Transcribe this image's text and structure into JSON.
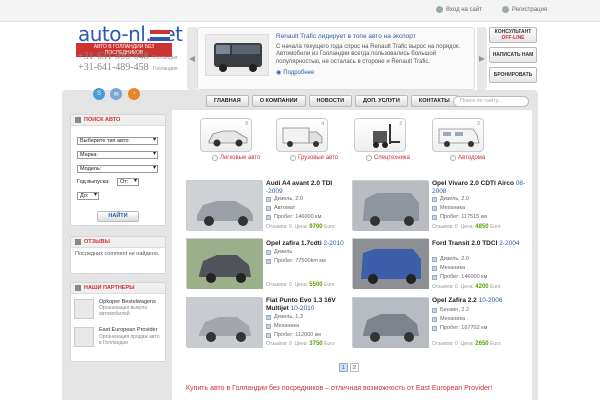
{
  "topbar": {
    "login": "Вход на сайт",
    "register": "Регистрация"
  },
  "logo": {
    "text": "auto-nl.net",
    "subtitle": "АВТО В ГОЛЛАНДИИ БЕЗ ПОСРЕДНИКОВ"
  },
  "phones": [
    {
      "number": "+31-631-993-048",
      "note": "Голландия"
    },
    {
      "number": "+31-641-489-458",
      "note": "Голландия"
    }
  ],
  "news": {
    "title": "Renault Trafic лидирует в топе авто на экспорт",
    "text": "С начала текущего года спрос на Renault Trafic вырос на порядок. Автомобили из Голландии всегда пользовались большой популярностью, не осталась в стороне и Renault Trafic.",
    "more": "Подробнее"
  },
  "side_buttons": [
    {
      "line1": "КОНСУЛЬТАНТ",
      "line2": "OFF-LINE"
    },
    {
      "line1": "НАПИСАТЬ НАМ",
      "line2": ""
    },
    {
      "line1": "БРОНИРОВАТЬ",
      "line2": ""
    }
  ],
  "nav": {
    "items": [
      "ГЛАВНАЯ",
      "О КОМПАНИИ",
      "НОВОСТИ",
      "ДОП. УСЛУГИ",
      "КОНТАКТЫ"
    ],
    "search_placeholder": "Поиск по сайту..."
  },
  "search_panel": {
    "title": "ПОИСК АВТО",
    "type_select": "Выберите тип авто:",
    "brand_select": "Марка:",
    "model_select": "Модель:",
    "year_label": "Год выпуска:",
    "year_from": "От:",
    "year_to": "До:",
    "find_button": "НАЙТИ"
  },
  "reviews": {
    "title": "ОТЗЫВЫ",
    "empty": "Последних comment не найдено."
  },
  "partners": {
    "title": "НАШИ ПАРТНЕРЫ",
    "items": [
      {
        "name": "Opkoper Bestelwagens",
        "desc": "Организация выкупа автомобилей"
      },
      {
        "name": "East European Provider",
        "desc": "Организация продаж авто в Голландии"
      }
    ]
  },
  "categories": [
    {
      "label": "Легковые авто",
      "count": "8"
    },
    {
      "label": "Грузовые авто",
      "count": "4"
    },
    {
      "label": "Спецтехника",
      "count": "2"
    },
    {
      "label": "Автодома",
      "count": "2"
    }
  ],
  "listings": [
    {
      "title": "Audi A4 avant 2.0 TDI",
      "year": "-2009",
      "specs": [
        "Дизель, 2.0",
        "Автомат",
        "Пробег: 146000 км"
      ],
      "reviews": "Отзывов: 0",
      "price_label": "Цена:",
      "price": "9700",
      "currency": "Euro"
    },
    {
      "title": "Opel Vivaro 2.0 CDTI Airco",
      "year": "08-2008",
      "specs": [
        "Дизель, 2.0",
        "Механика",
        "Пробег: 117515 км"
      ],
      "reviews": "Отзывов: 0",
      "price_label": "Цена:",
      "price": "4850",
      "currency": "Euro"
    },
    {
      "title": "Opel zafira 1.7cdti",
      "year": "2-2010",
      "specs": [
        "Дизель",
        "Пробег: 77500km км"
      ],
      "reviews": "Отзывов: 0",
      "price_label": "Цена:",
      "price": "5500",
      "currency": "Euro"
    },
    {
      "title": "Ford Transit 2.0 TDCI",
      "year": "2-2004",
      "specs": [
        "Дизель, 2.0",
        "Механика",
        "Пробег: 146000 км"
      ],
      "reviews": "Отзывов: 0",
      "price_label": "Цена:",
      "price": "4200",
      "currency": "Euro"
    },
    {
      "title": "Fiat Punto Evo 1.3 16V Multijet",
      "year": "10-2010",
      "specs": [
        "Дизель, 1.3",
        "Механика",
        "Пробег: 112000 км"
      ],
      "reviews": "Отзывов: 0",
      "price_label": "Цена:",
      "price": "3750",
      "currency": "Euro"
    },
    {
      "title": "Opel Zafira 2.2",
      "year": "10-2006",
      "specs": [
        "Бензин, 2.2",
        "Механика",
        "Пробег: 167702 км"
      ],
      "reviews": "Отзывов: 0",
      "price_label": "Цена:",
      "price": "2650",
      "currency": "Euro"
    }
  ],
  "pager": [
    "1",
    "2"
  ],
  "slogan": "Купить авто в Голландии без посредников – отличная возможность от East European Provider!",
  "colors": {
    "brand_blue": "#2a5bb0",
    "accent_red": "#cc3333",
    "price_green": "#58a000",
    "frame_gray": "#e4e4e4"
  }
}
